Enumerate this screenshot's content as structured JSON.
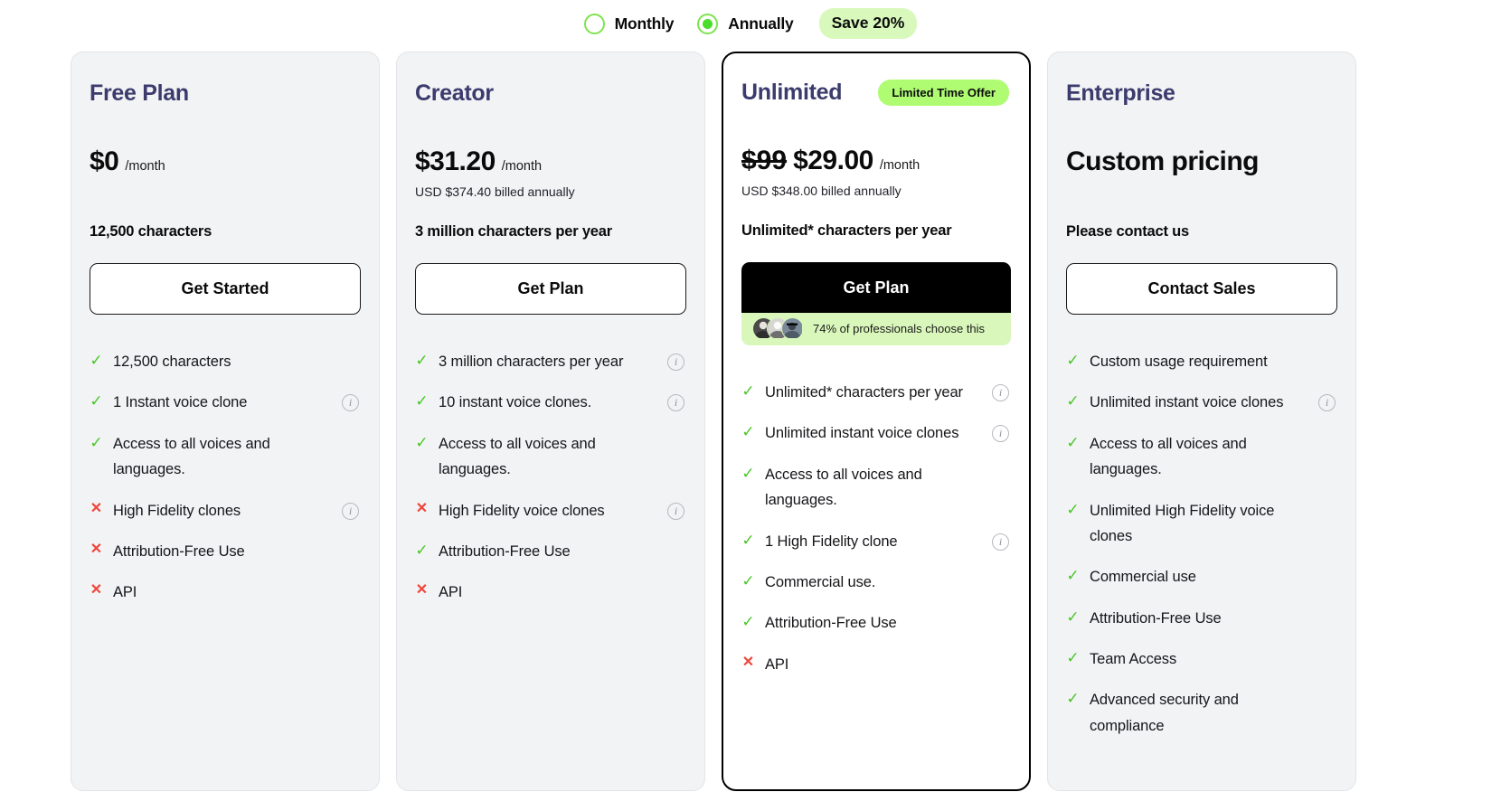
{
  "billing_toggle": {
    "options": [
      {
        "label": "Monthly",
        "selected": false
      },
      {
        "label": "Annually",
        "selected": true
      }
    ],
    "save_badge": "Save 20%",
    "accent_green": "#4ade2a",
    "badge_bg": "#d8f8bc"
  },
  "plans": [
    {
      "name": "Free Plan",
      "badge": null,
      "price_old": null,
      "price": "$0",
      "period": "/month",
      "billed_note": "",
      "quota": "12,500 characters",
      "cta": "Get Started",
      "cta_style": "outline",
      "social_proof": null,
      "features": [
        {
          "included": true,
          "text": "12,500 characters",
          "info": false
        },
        {
          "included": true,
          "text": "1 Instant voice clone",
          "info": true
        },
        {
          "included": true,
          "text": "Access to all voices and languages.",
          "info": false
        },
        {
          "included": false,
          "text": "High Fidelity clones",
          "info": true
        },
        {
          "included": false,
          "text": "Attribution-Free Use",
          "info": false
        },
        {
          "included": false,
          "text": "API",
          "info": false
        }
      ]
    },
    {
      "name": "Creator",
      "badge": null,
      "price_old": null,
      "price": "$31.20",
      "period": "/month",
      "billed_note": "USD $374.40 billed annually",
      "quota": "3 million characters per year",
      "cta": "Get Plan",
      "cta_style": "outline",
      "social_proof": null,
      "features": [
        {
          "included": true,
          "text": "3 million characters per year",
          "info": true
        },
        {
          "included": true,
          "text": "10 instant voice clones.",
          "info": true
        },
        {
          "included": true,
          "text": "Access to all voices and languages.",
          "info": false
        },
        {
          "included": false,
          "text": "High Fidelity voice clones",
          "info": true
        },
        {
          "included": true,
          "text": "Attribution-Free Use",
          "info": false
        },
        {
          "included": false,
          "text": "API",
          "info": false
        }
      ]
    },
    {
      "name": "Unlimited",
      "badge": "Limited Time Offer",
      "price_old": "$99",
      "price": "$29.00",
      "period": "/month",
      "billed_note": "USD $348.00 billed annually",
      "quota": "Unlimited* characters per year",
      "cta": "Get Plan",
      "cta_style": "dark",
      "social_proof": "74% of professionals choose this",
      "features": [
        {
          "included": true,
          "text": "Unlimited* characters per year",
          "info": true
        },
        {
          "included": true,
          "text": "Unlimited instant voice clones",
          "info": true
        },
        {
          "included": true,
          "text": "Access to all voices and languages.",
          "info": false
        },
        {
          "included": true,
          "text": "1 High Fidelity clone",
          "info": true
        },
        {
          "included": true,
          "text": "Commercial use.",
          "info": false
        },
        {
          "included": true,
          "text": "Attribution-Free Use",
          "info": false
        },
        {
          "included": false,
          "text": "API",
          "info": false
        }
      ]
    },
    {
      "name": "Enterprise",
      "badge": null,
      "price_old": null,
      "price": "Custom pricing",
      "period": "",
      "billed_note": "",
      "quota": "Please contact us",
      "cta": "Contact Sales",
      "cta_style": "outline",
      "social_proof": null,
      "features": [
        {
          "included": true,
          "text": "Custom usage requirement",
          "info": false
        },
        {
          "included": true,
          "text": "Unlimited instant voice clones",
          "info": true
        },
        {
          "included": true,
          "text": "Access to all voices and languages.",
          "info": false
        },
        {
          "included": true,
          "text": "Unlimited High Fidelity voice clones",
          "info": false
        },
        {
          "included": true,
          "text": "Commercial use",
          "info": false
        },
        {
          "included": true,
          "text": "Attribution-Free Use",
          "info": false
        },
        {
          "included": true,
          "text": "Team Access",
          "info": false
        },
        {
          "included": true,
          "text": "Advanced security and compliance",
          "info": false
        }
      ]
    }
  ],
  "icons": {
    "check": "✓",
    "cross": "✕",
    "info": "i"
  }
}
